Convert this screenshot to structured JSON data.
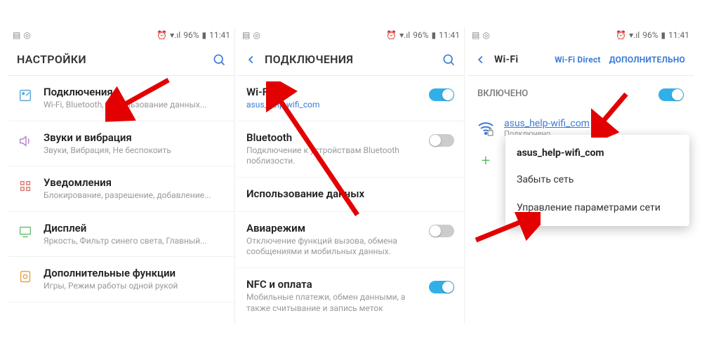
{
  "status": {
    "battery": "96%",
    "time": "11:41"
  },
  "p1": {
    "title": "НАСТРОЙКИ",
    "items": [
      {
        "title": "Подключения",
        "sub": "Wi-Fi, Bluetooth, Использование данных..."
      },
      {
        "title": "Звуки и вибрация",
        "sub": "Звуки, Вибрация, Не беспокоить"
      },
      {
        "title": "Уведомления",
        "sub": "Блокирование, разрешение, добавление..."
      },
      {
        "title": "Дисплей",
        "sub": "Яркость, Фильтр синего света, Главный..."
      },
      {
        "title": "Дополнительные функции",
        "sub": "Игры, Режим работы одной рукой"
      }
    ]
  },
  "p2": {
    "title": "ПОДКЛЮЧЕНИЯ",
    "items": [
      {
        "title": "Wi-Fi",
        "sub": "asus_help-wifi_com",
        "toggle": true
      },
      {
        "title": "Bluetooth",
        "sub": "Подключение к устройствам Bluetooth поблизости.",
        "toggle": false
      },
      {
        "title": "Использование данных",
        "sub": ""
      },
      {
        "title": "Авиарежим",
        "sub": "Отключение функций вызова, обмена сообщениями и мобильных данных.",
        "toggle": false
      },
      {
        "title": "NFC и оплата",
        "sub": "Мобильные платежи, обмен данными, а также считывание и запись меток",
        "toggle": true
      }
    ]
  },
  "p3": {
    "title": "Wi-Fi",
    "direct": "Wi-Fi Direct",
    "more": "ДОПОЛНИТЕЛЬНО",
    "enabled": "ВКЛЮЧЕНО",
    "net": {
      "name": "asus_help-wifi_com",
      "status": "Подключено"
    },
    "popup": {
      "title": "asus_help-wifi_com",
      "forget": "Забыть сеть",
      "manage": "Управление параметрами сети"
    }
  }
}
